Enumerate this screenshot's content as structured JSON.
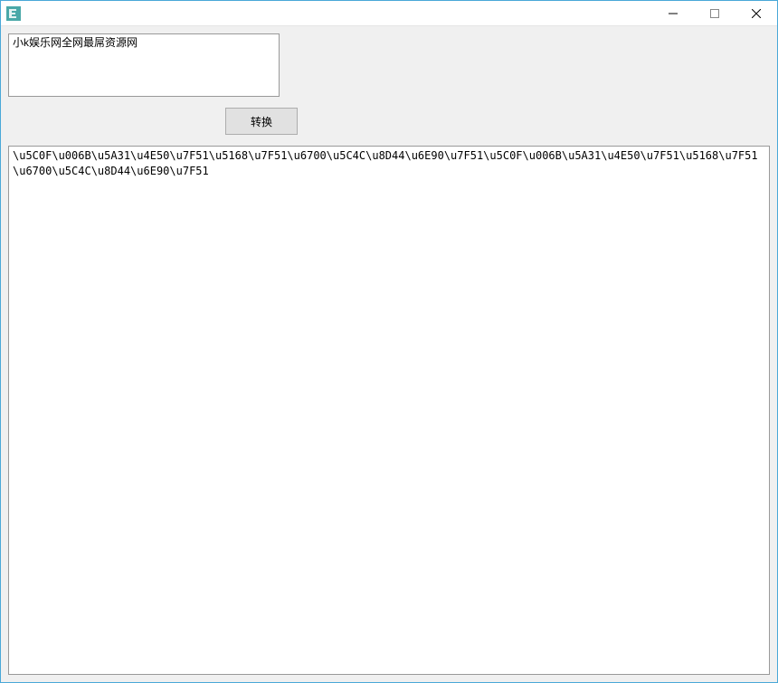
{
  "window": {
    "title": "",
    "icon_name": "e-lang-icon"
  },
  "input": {
    "value": "小k娱乐网全网最屌资源网"
  },
  "convert_button": {
    "label": "转换"
  },
  "output": {
    "value": "\\u5C0F\\u006B\\u5A31\\u4E50\\u7F51\\u5168\\u7F51\\u6700\\u5C4C\\u8D44\\u6E90\\u7F51\\u5C0F\\u006B\\u5A31\\u4E50\\u7F51\\u5168\\u7F51\\u6700\\u5C4C\\u8D44\\u6E90\\u7F51"
  }
}
